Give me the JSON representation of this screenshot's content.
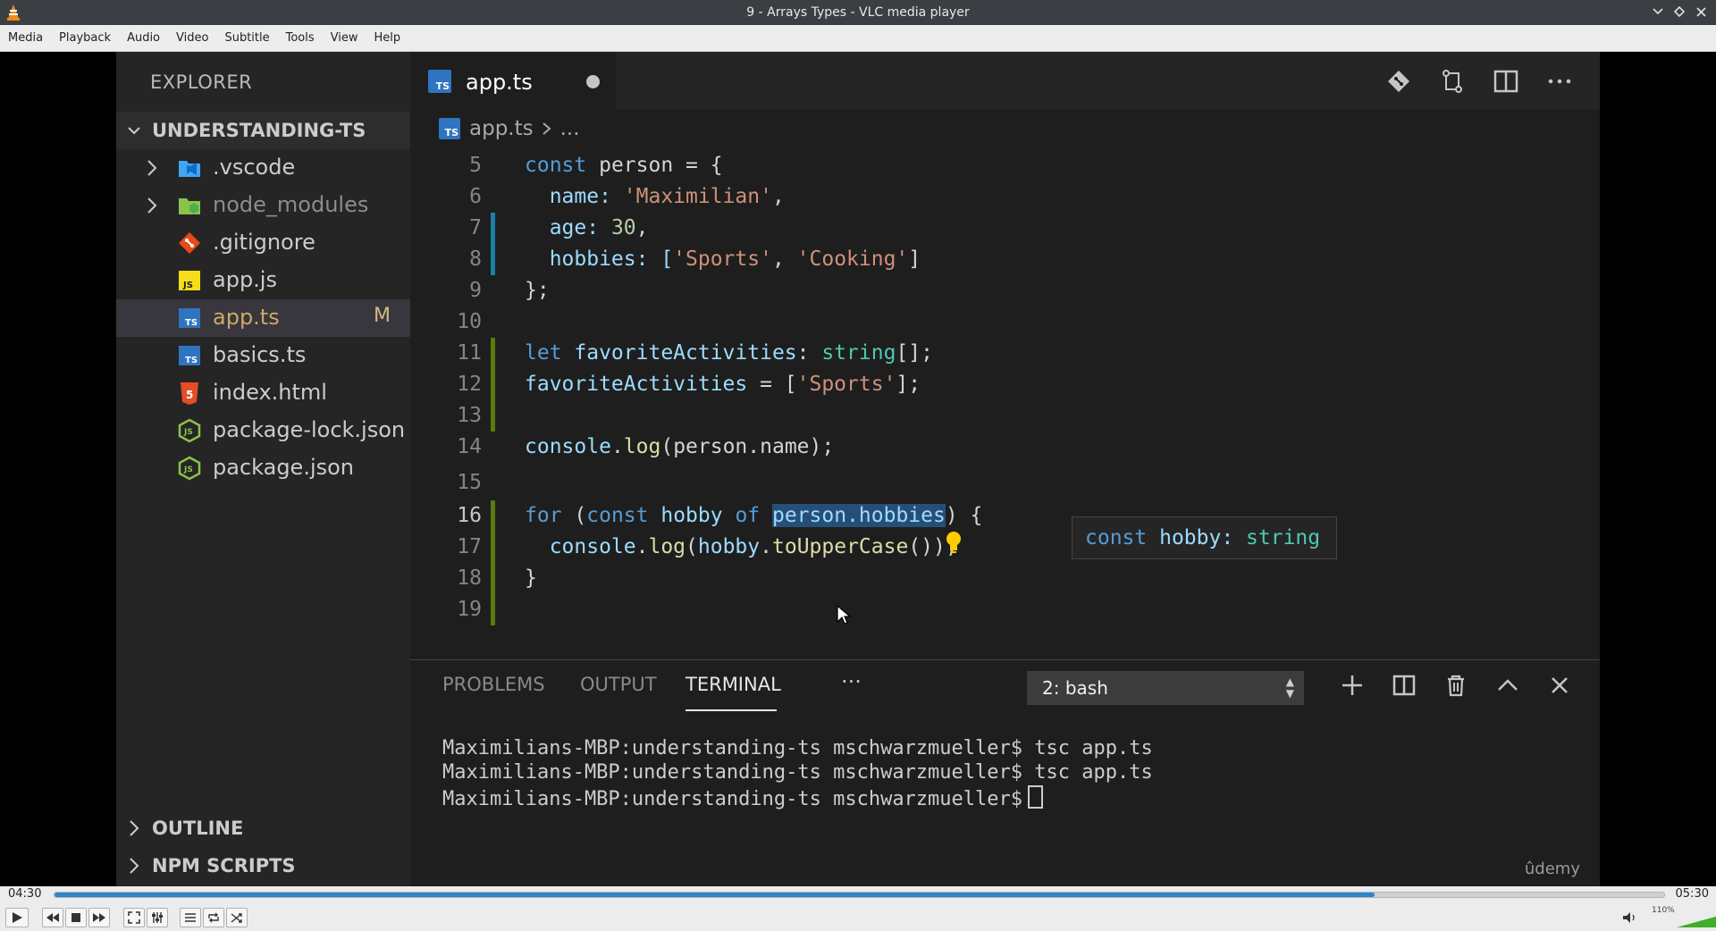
{
  "window": {
    "title": "9 - Arrays Types - VLC media player"
  },
  "menu": [
    "Media",
    "Playback",
    "Audio",
    "Video",
    "Subtitle",
    "Tools",
    "View",
    "Help"
  ],
  "vscode": {
    "explorer_title": "EXPLORER",
    "root_folder": "UNDERSTANDING-TS",
    "files": [
      {
        "name": ".vscode",
        "type": "folder",
        "icon": "vscode-folder-icon"
      },
      {
        "name": "node_modules",
        "type": "folder",
        "icon": "node-folder-icon"
      },
      {
        "name": ".gitignore",
        "type": "file",
        "icon": "git-icon"
      },
      {
        "name": "app.js",
        "type": "file",
        "icon": "js-file-icon"
      },
      {
        "name": "app.ts",
        "type": "file",
        "icon": "ts-file-icon",
        "badge": "M"
      },
      {
        "name": "basics.ts",
        "type": "file",
        "icon": "ts-file-icon"
      },
      {
        "name": "index.html",
        "type": "file",
        "icon": "html-file-icon"
      },
      {
        "name": "package-lock.json",
        "type": "file",
        "icon": "node-json-icon"
      },
      {
        "name": "package.json",
        "type": "file",
        "icon": "node-json-icon"
      }
    ],
    "outline_label": "OUTLINE",
    "npm_scripts_label": "NPM SCRIPTS",
    "tab_label": "app.ts",
    "tab_ts_badge": "TS",
    "breadcrumb_file": "app.ts",
    "breadcrumb_more": "...",
    "line_numbers": [
      "5",
      "6",
      "7",
      "8",
      "9",
      "10",
      "11",
      "12",
      "13",
      "14",
      "15",
      "16",
      "17",
      "18",
      "19"
    ],
    "code_text": {
      "l5_kw": "const",
      "l5_rest": " person = {",
      "l6_key": "  name: ",
      "l6_val": "'Maximilian'",
      "l6_end": ",",
      "l7_key": "  age: ",
      "l7_val": "30",
      "l7_end": ",",
      "l8_key": "  hobbies: [",
      "l8_v1": "'Sports'",
      "l8_sep": ", ",
      "l8_v2": "'Cooking'",
      "l8_end": "]",
      "l9": "};",
      "l11_kw": "let",
      "l11_var": " favoriteActivities",
      "l11_colon": ": ",
      "l11_ty": "string",
      "l11_end": "[];",
      "l12_var": "favoriteActivities",
      "l12_mid": " = [",
      "l12_val": "'Sports'",
      "l12_end": "];",
      "l14_obj": "console",
      "l14_dot": ".",
      "l14_fn": "log",
      "l14_rest": "(person.name);",
      "l16_kw": "for",
      "l16_open": " (",
      "l16_const": "const",
      "l16_var": " hobby",
      "l16_of": " of ",
      "l16_hl": "person.hobbies",
      "l16_end": ") {",
      "l17_obj": "  console",
      "l17_dot": ".",
      "l17_fn": "log",
      "l17_open": "(",
      "l17_var": "hobby",
      "l17_dot2": ".",
      "l17_fn2": "toUpperCase",
      "l17_end": "());",
      "l18": "}"
    },
    "hover": {
      "kw": "const",
      "name": " hobby: ",
      "type": "string"
    },
    "panel_tabs": [
      "PROBLEMS",
      "OUTPUT",
      "TERMINAL"
    ],
    "panel_more": "···",
    "terminal_select": "2: bash",
    "terminal_lines": [
      "Maximilians-MBP:understanding-ts mschwarzmueller$ tsc app.ts",
      "Maximilians-MBP:understanding-ts mschwarzmueller$ tsc app.ts",
      "Maximilians-MBP:understanding-ts mschwarzmueller$"
    ],
    "watermark": "ûdemy"
  },
  "player": {
    "elapsed": "04:30",
    "total": "05:30",
    "progress_fraction": 0.82,
    "volume_label": "110%",
    "volume_fraction": 0.9
  },
  "colors": {
    "seek_fill": "#2e84c7",
    "volume_green": "#3fae29"
  }
}
